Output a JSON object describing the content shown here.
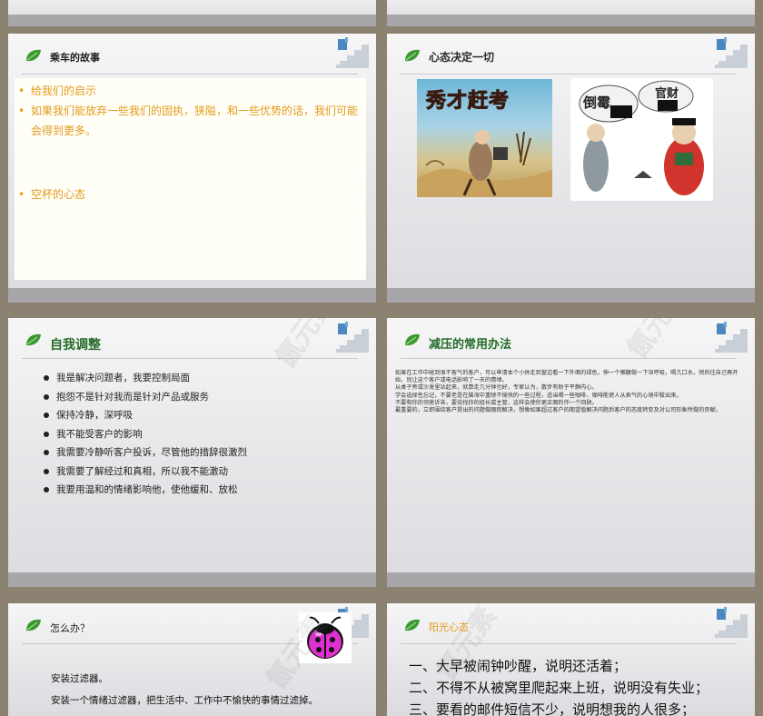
{
  "slides": {
    "story": {
      "title": "乘车的故事",
      "bullets": [
        {
          "marker": "•",
          "text": "给我们的启示"
        },
        {
          "marker": "•",
          "text": "如果我们能放弃一些我们的固执，狭隘，和一些优势的话，我们可能会得到更多。"
        },
        {
          "marker": "•",
          "text": "空杯的心态"
        }
      ]
    },
    "mindset": {
      "title": "心态决定一切",
      "image_left_caption": "秀才赶考",
      "image_right_words": [
        "倒霉",
        "官财"
      ]
    },
    "self_adjust": {
      "title": "自我调整",
      "bullets": [
        "我是解决问题者，我要控制局面",
        "抱怨不是针对我而是针对产品或服务",
        "保持冷静，深呼吸",
        "我不能受客户的影响",
        "我需要冷静听客户投诉，尽管他的措辞很激烈",
        "我需要了解经过和真相，所以我不能激动",
        "我要用温和的情绪影响他，使他缓和、放松"
      ]
    },
    "stress": {
      "title": "减压的常用办法",
      "paragraphs": [
        "如果在工作中碰到很不客气的客户，可以申请本个小休走到窗边看一下外面的绿色，伸一个懒腰做一下深呼吸，喝几口水，然后往自己再开始，别让这个客户或电话影响了一天的情绪。",
        "从桌子旁或沙发里站起来，就算走几分钟也好，专家认为，散步有助于平静内心。",
        "学会选择性忘记，不要老是在脑海中重映不愉快的一些过程，适当喝一些咖啡，咖啡能使人从表气的心境中拔出来。",
        "不要和你的邻座诉苦，要说找你的组长或主管，这样会使你更正面的作一个回顾。",
        "最重要的，立即围绕客户提出的问题做跟踪解决，想像如果超过客户的期望值解决问题后客户的态度转变及对公司形象所做的贡献。"
      ]
    },
    "what_to_do": {
      "title": "怎么办？",
      "lines": [
        "安装过滤器。",
        "安装一个情绪过滤器，把生活中、工作中不愉快的事情过滤掉。"
      ]
    },
    "sunny": {
      "title": "阳光心态",
      "lines": [
        "一、大早被闹钟吵醒，说明还活着；",
        "二、不得不从被窝里爬起来上班，说明没有失业；",
        "三、要看的邮件短信不少，说明想我的人很多；"
      ]
    }
  },
  "watermark": "氤元素",
  "colors": {
    "leaf": "#3a9a2e",
    "orange_text": "#e39a1b",
    "footer": "#a7a7a9",
    "background": "#8c8272"
  },
  "icons": [
    "leaf-icon",
    "stairs-icon",
    "ladybug-icon"
  ]
}
